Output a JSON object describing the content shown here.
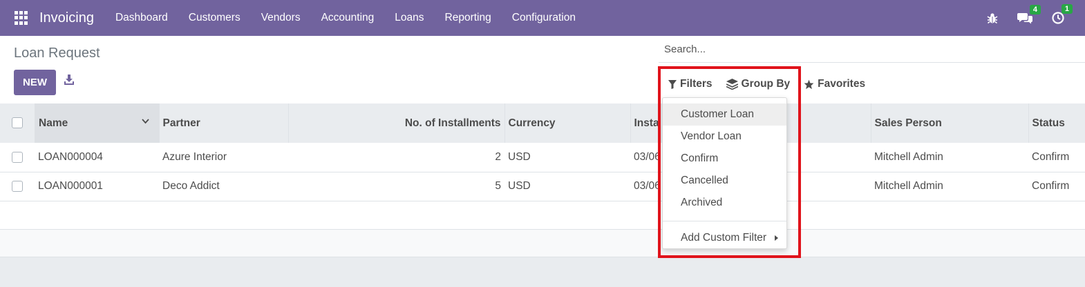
{
  "navbar": {
    "app_name": "Invoicing",
    "menu": [
      "Dashboard",
      "Customers",
      "Vendors",
      "Accounting",
      "Loans",
      "Reporting",
      "Configuration"
    ],
    "icons": {
      "debug": "bug-icon",
      "messages": "chat-icon",
      "activities": "clock-icon"
    },
    "messages_count": "4",
    "activities_count": "1",
    "badge_color": "#28a745",
    "brand_color": "#71639e"
  },
  "control_panel": {
    "title": "Loan Request",
    "new_label": "NEW",
    "search_placeholder": "Search...",
    "filters_label": "Filters",
    "group_by_label": "Group By",
    "favorites_label": "Favorites"
  },
  "table": {
    "headers": [
      "Name",
      "Partner",
      "No. of Installments",
      "Currency",
      "Insta",
      "Sales Person",
      "Status"
    ],
    "rows": [
      {
        "name": "LOAN000004",
        "partner": "Azure Interior",
        "installments": "2",
        "currency": "USD",
        "date": "03/06",
        "sales_person": "Mitchell Admin",
        "status": "Confirm"
      },
      {
        "name": "LOAN000001",
        "partner": "Deco Addict",
        "installments": "5",
        "currency": "USD",
        "date": "03/06",
        "sales_person": "Mitchell Admin",
        "status": "Confirm"
      }
    ]
  },
  "filters_dropdown": {
    "items": [
      "Customer Loan",
      "Vendor Loan",
      "Confirm",
      "Cancelled",
      "Archived"
    ],
    "add_custom": "Add Custom Filter"
  },
  "highlight_color": "#e0131b"
}
